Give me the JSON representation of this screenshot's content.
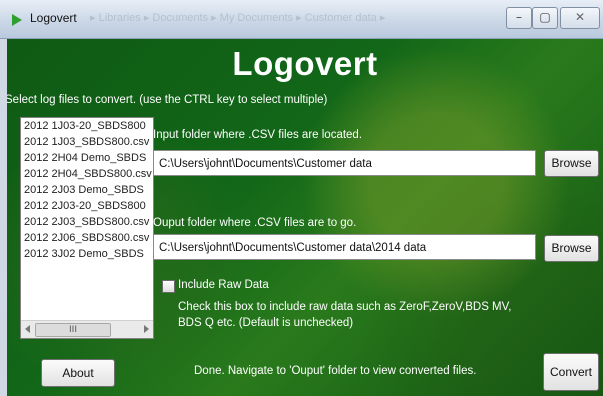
{
  "window": {
    "title": "Logovert",
    "breadcrumb": "▸ Libraries ▸ Documents ▸ My Documents ▸ Customer data ▸",
    "min_glyph": "–",
    "max_glyph": "▢",
    "close_glyph": "✕"
  },
  "header": {
    "logo": "Logovert"
  },
  "instruction": "Select log files to convert. (use the CTRL key to select multiple)",
  "files": [
    "2012 1J03-20_SBDS800",
    "2012 1J03_SBDS800.csv",
    "2012 2H04 Demo_SBDS",
    "2012 2H04_SBDS800.csv",
    "2012 2J03 Demo_SBDS",
    "2012 2J03-20_SBDS800",
    "2012 2J03_SBDS800.csv",
    "2012 2J06_SBDS800.csv",
    "2012 3J02 Demo_SBDS"
  ],
  "scroll_thumb": "III",
  "input_folder": {
    "label": "Input folder where .CSV files are located.",
    "value": "C:\\Users\\johnt\\Documents\\Customer data",
    "browse": "Browse"
  },
  "output_folder": {
    "label": "Ouput folder where .CSV files are to go.",
    "value": "C:\\Users\\johnt\\Documents\\Customer data\\2014 data",
    "browse": "Browse"
  },
  "raw_data": {
    "label": "Include Raw Data",
    "checked": false,
    "help_line1": "Check this box to include raw data such as ZeroF,ZeroV,BDS MV,",
    "help_line2": "BDS Q etc. (Default is unchecked)"
  },
  "status": "Done. Navigate to 'Ouput' folder to view converted files.",
  "buttons": {
    "about": "About",
    "convert": "Convert"
  },
  "colors": {
    "panel_green": "#126718",
    "text_white": "#ffffff",
    "play_icon_green": "#2fa02f"
  }
}
